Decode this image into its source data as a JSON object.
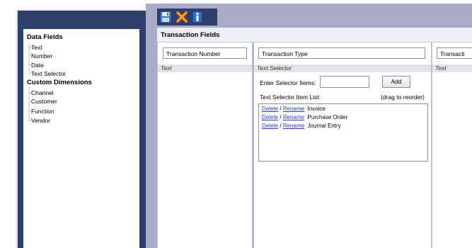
{
  "toolbar": {
    "buttons": [
      {
        "name": "save-icon"
      },
      {
        "name": "delete-icon"
      },
      {
        "name": "info-icon"
      }
    ]
  },
  "tree": {
    "groups": [
      {
        "label": "Data Fields",
        "items": [
          "Text",
          "Number",
          "Date",
          "Text Selector"
        ]
      },
      {
        "label": "Custom Dimensions",
        "items": [
          "Channel",
          "Customer",
          "Function",
          "Vendor"
        ]
      }
    ]
  },
  "section": {
    "title": "Transaction Fields"
  },
  "columns": [
    {
      "name_value": "Transaction Number",
      "type": "Text"
    },
    {
      "name_value": "Transaction Type",
      "type": "Text Selector"
    },
    {
      "name_value": "Transacti",
      "type": "Text"
    }
  ],
  "selector": {
    "enter_label": "Enter Selector Items:",
    "add_label": "Add",
    "list_label": "Text Selector Item List:",
    "reorder_hint": "(drag to reorder)",
    "delete_label": "Delete",
    "slash": "/",
    "rename_label": "Rename",
    "items": [
      "Invoice",
      "Purchase Order",
      "Journal Entry"
    ]
  }
}
